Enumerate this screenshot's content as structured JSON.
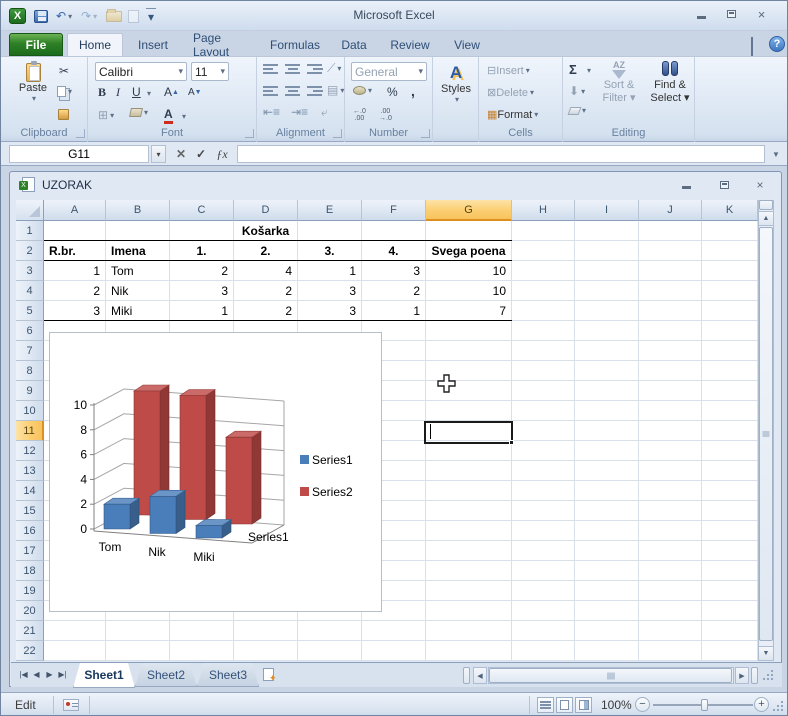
{
  "window": {
    "title": "Microsoft Excel"
  },
  "qat": {
    "icons": [
      "excel-logo",
      "save",
      "undo",
      "redo",
      "open",
      "new-document",
      "customize-qat"
    ]
  },
  "ribbon_tabs": {
    "file": "File",
    "items": [
      "Home",
      "Insert",
      "Page Layout",
      "Formulas",
      "Data",
      "Review",
      "View"
    ],
    "active": "Home"
  },
  "ribbon": {
    "clipboard": {
      "label": "Clipboard",
      "paste": "Paste"
    },
    "font": {
      "label": "Font",
      "family": "Calibri",
      "size": "11",
      "bold": "B",
      "italic": "I",
      "underline": "U",
      "grow": "A",
      "shrink": "A"
    },
    "alignment": {
      "label": "Alignment"
    },
    "number": {
      "label": "Number",
      "format": "General",
      "percent": "%",
      "comma": ",",
      "increase_decimal": [
        "←.0",
        ".00"
      ],
      "decrease_decimal": [
        ".00",
        "→.0"
      ]
    },
    "styles": {
      "label": "Styles",
      "icon_letter": "A"
    },
    "cells": {
      "label": "Cells",
      "insert": "Insert",
      "delete": "Delete",
      "format": "Format"
    },
    "editing": {
      "label": "Editing",
      "autosum": "Σ",
      "sort_line1": "Sort &",
      "sort_line2": "Filter",
      "find_line1": "Find &",
      "find_line2": "Select",
      "az": "AZ"
    }
  },
  "formula_bar": {
    "name_box": "G11",
    "formula": "",
    "cancel": "✕",
    "enter": "✓",
    "fx": "ƒx"
  },
  "workbook": {
    "title": "UZORAK",
    "column_headers": [
      "A",
      "B",
      "C",
      "D",
      "E",
      "F",
      "G",
      "H",
      "I",
      "J",
      "K"
    ],
    "selected_column": "G",
    "row_count": 22,
    "selected_row": 11,
    "selected_cell": "G11"
  },
  "sheet_cells": [
    {
      "ref": "D1",
      "text": "Košarka",
      "bold": true,
      "align": "center"
    },
    {
      "ref": "A2",
      "text": "R.br.",
      "bold": true,
      "align": "left"
    },
    {
      "ref": "B2",
      "text": "Imena",
      "bold": true,
      "align": "left"
    },
    {
      "ref": "C2",
      "text": "1.",
      "bold": true,
      "align": "center"
    },
    {
      "ref": "D2",
      "text": "2.",
      "bold": true,
      "align": "center"
    },
    {
      "ref": "E2",
      "text": "3.",
      "bold": true,
      "align": "center"
    },
    {
      "ref": "F2",
      "text": "4.",
      "bold": true,
      "align": "center"
    },
    {
      "ref": "G2",
      "text": "Svega poena",
      "bold": true,
      "align": "center"
    },
    {
      "ref": "A3",
      "text": "1",
      "align": "right"
    },
    {
      "ref": "B3",
      "text": "Tom",
      "align": "left"
    },
    {
      "ref": "C3",
      "text": "2",
      "align": "right"
    },
    {
      "ref": "D3",
      "text": "4",
      "align": "right"
    },
    {
      "ref": "E3",
      "text": "1",
      "align": "right"
    },
    {
      "ref": "F3",
      "text": "3",
      "align": "right"
    },
    {
      "ref": "G3",
      "text": "10",
      "align": "right"
    },
    {
      "ref": "A4",
      "text": "2",
      "align": "right"
    },
    {
      "ref": "B4",
      "text": "Nik",
      "align": "left"
    },
    {
      "ref": "C4",
      "text": "3",
      "align": "right"
    },
    {
      "ref": "D4",
      "text": "2",
      "align": "right"
    },
    {
      "ref": "E4",
      "text": "3",
      "align": "right"
    },
    {
      "ref": "F4",
      "text": "2",
      "align": "right"
    },
    {
      "ref": "G4",
      "text": "10",
      "align": "right"
    },
    {
      "ref": "A5",
      "text": "3",
      "align": "right"
    },
    {
      "ref": "B5",
      "text": "Miki",
      "align": "left"
    },
    {
      "ref": "C5",
      "text": "1",
      "align": "right"
    },
    {
      "ref": "D5",
      "text": "2",
      "align": "right"
    },
    {
      "ref": "E5",
      "text": "3",
      "align": "right"
    },
    {
      "ref": "F5",
      "text": "1",
      "align": "right"
    },
    {
      "ref": "G5",
      "text": "7",
      "align": "right"
    }
  ],
  "chart_data": {
    "type": "bar",
    "subtype": "3d-clustered-column",
    "categories": [
      "Tom",
      "Nik",
      "Miki"
    ],
    "series": [
      {
        "name": "Series1",
        "color": "#4A7EBB",
        "values": [
          2,
          3,
          1
        ]
      },
      {
        "name": "Series2",
        "color": "#BE4B48",
        "values": [
          10,
          10,
          7
        ]
      }
    ],
    "ylim": [
      0,
      10
    ],
    "yticks": [
      0,
      2,
      4,
      6,
      8,
      10
    ],
    "depth_axis_label": "Series1",
    "legend": [
      "Series1",
      "Series2"
    ],
    "legend_position": "right",
    "grid": true,
    "title": "",
    "xlabel": "",
    "ylabel": ""
  },
  "sheet_tabs": {
    "tabs": [
      "Sheet1",
      "Sheet2",
      "Sheet3"
    ],
    "active": "Sheet1"
  },
  "status_bar": {
    "mode": "Edit",
    "zoom_level": "100%"
  },
  "colors": {
    "selected_header": "#F8C35F",
    "file_tab_green": "#2E8126",
    "series1_blue": "#4A7EBB",
    "series2_red": "#BE4B48",
    "gridline": "#D9E0EA"
  }
}
